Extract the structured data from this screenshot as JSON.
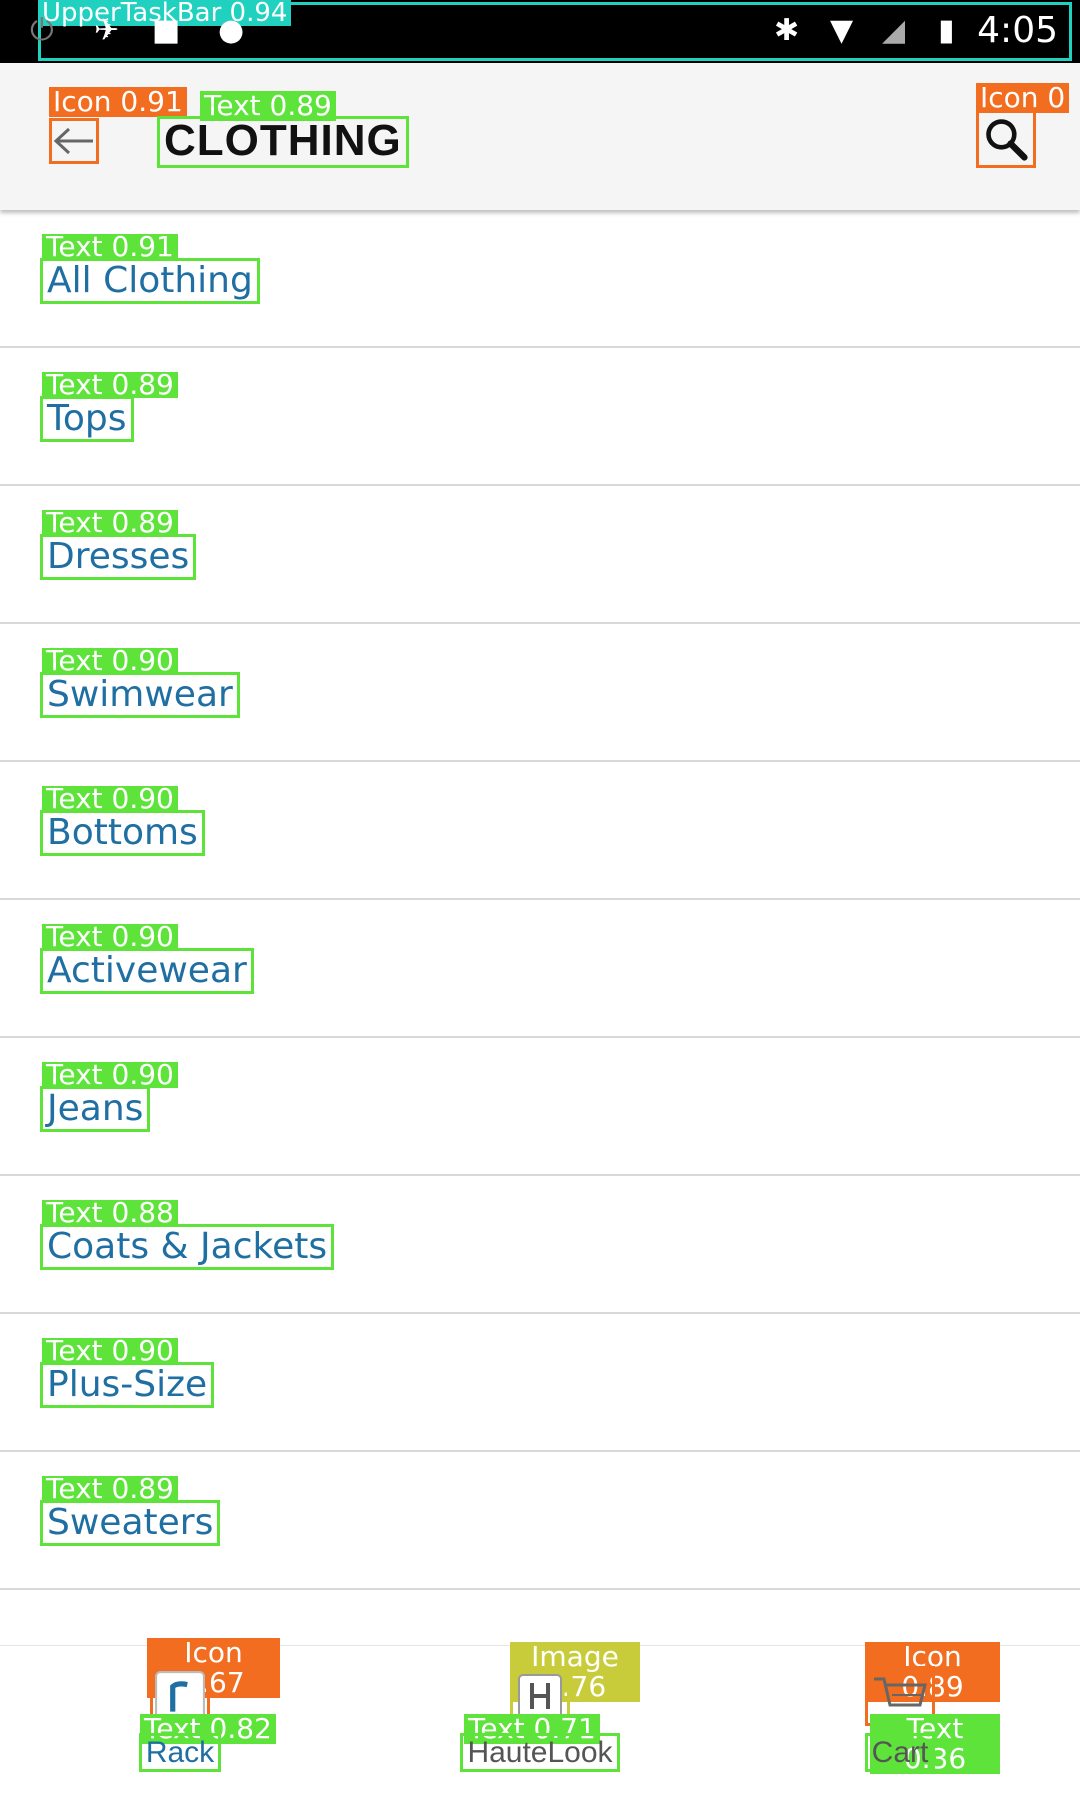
{
  "status_bar": {
    "time": "4:05",
    "overlay_label": "UpperTaskBar 0.94",
    "icons": [
      "power-icon",
      "satellite-icon",
      "lock-icon",
      "android-icon",
      "bluetooth-icon",
      "wifi-icon",
      "no-signal-icon",
      "battery-charging-icon"
    ]
  },
  "app_bar": {
    "title": "CLOTHING",
    "back_icon": "back-arrow-icon",
    "search_icon": "search-icon",
    "overlay_back": "Icon 0.91",
    "overlay_title": "Text 0.89",
    "overlay_search": "Icon 0"
  },
  "categories": [
    {
      "label": "All Clothing",
      "overlay": "Text 0.91"
    },
    {
      "label": "Tops",
      "overlay": "Text 0.89"
    },
    {
      "label": "Dresses",
      "overlay": "Text 0.89"
    },
    {
      "label": "Swimwear",
      "overlay": "Text 0.90"
    },
    {
      "label": "Bottoms",
      "overlay": "Text 0.90"
    },
    {
      "label": "Activewear",
      "overlay": "Text 0.90"
    },
    {
      "label": "Jeans",
      "overlay": "Text 0.90"
    },
    {
      "label": "Coats & Jackets",
      "overlay": "Text 0.88"
    },
    {
      "label": "Plus-Size",
      "overlay": "Text 0.90"
    },
    {
      "label": "Sweaters",
      "overlay": "Text 0.89"
    }
  ],
  "bottom_nav": [
    {
      "label": "Rack",
      "icon": "rack-icon",
      "overlay_icon": "Icon 0.67",
      "overlay_text": "Text 0.82"
    },
    {
      "label": "HauteLook",
      "icon": "hautelook-icon",
      "overlay_icon": "Image 0.76",
      "overlay_text": "Text 0.71"
    },
    {
      "label": "Cart",
      "icon": "cart-icon",
      "overlay_icon": "Icon 0.89",
      "overlay_text": "Text 0.36"
    }
  ],
  "colors": {
    "accent_text": "#1f6fa3",
    "overlay_green": "#5ee33b",
    "overlay_orange": "#f26d1f",
    "overlay_teal": "#21d1c0",
    "overlay_yellow": "#c9cc3a"
  }
}
